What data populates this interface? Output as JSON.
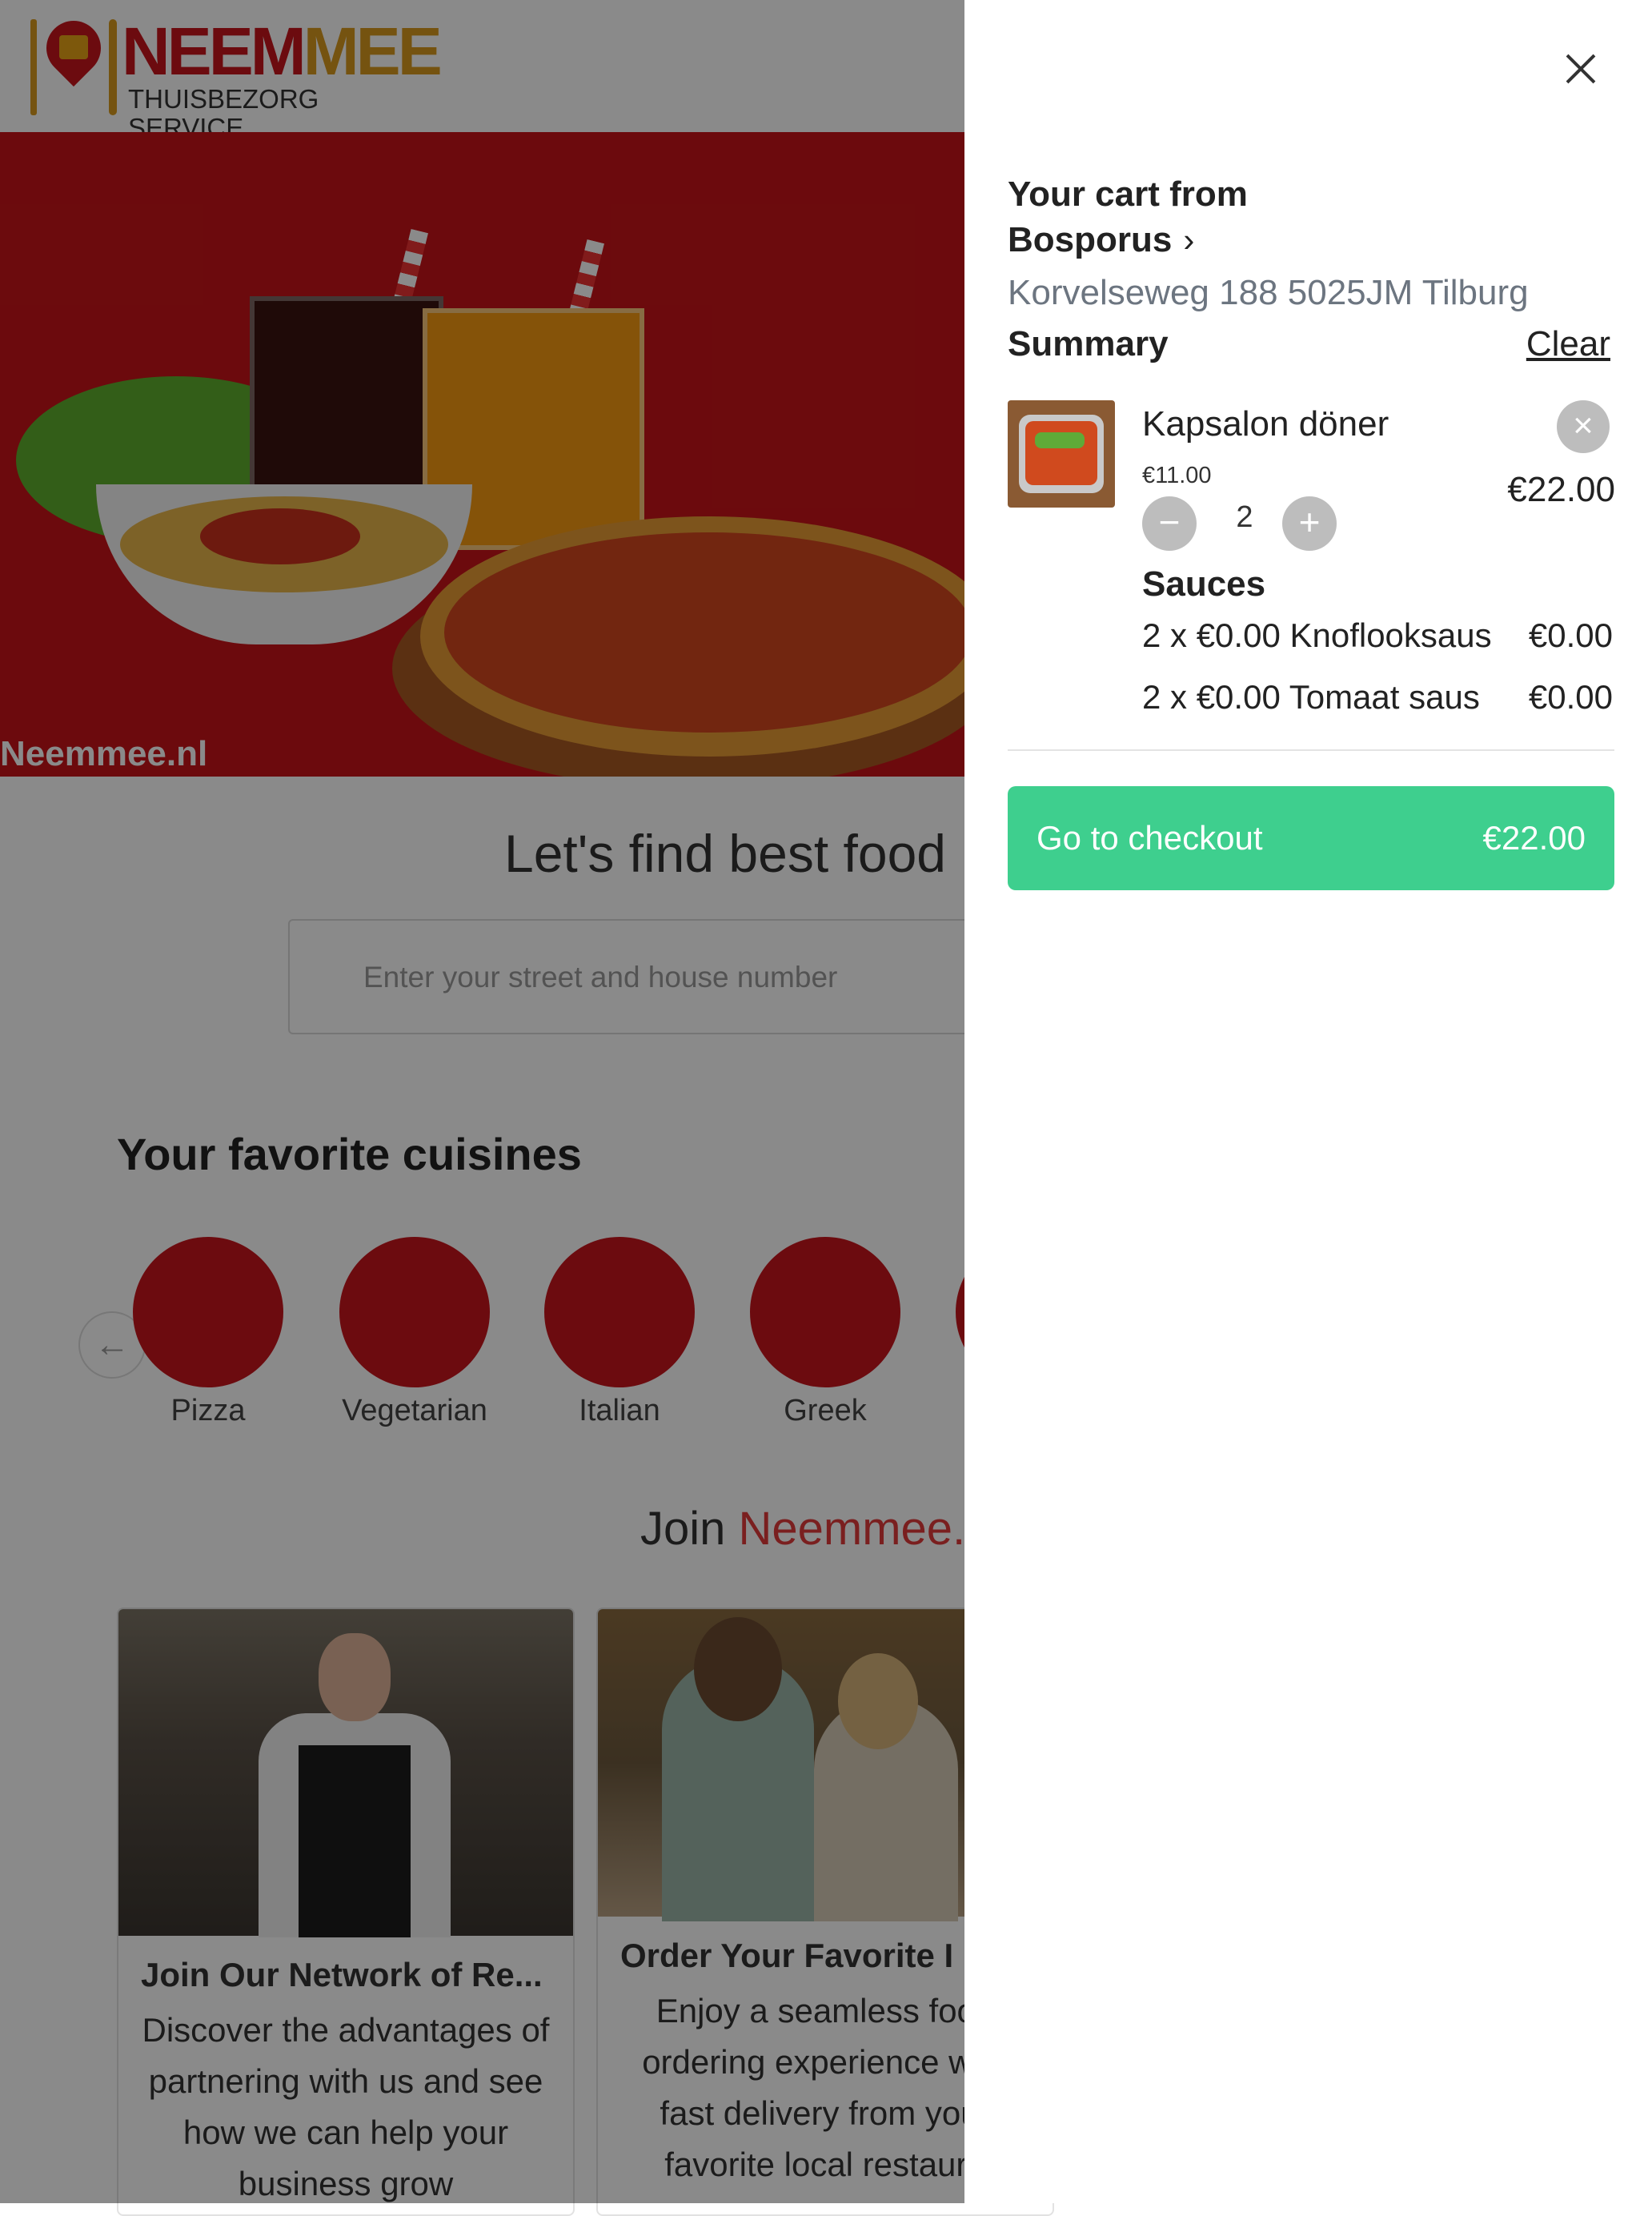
{
  "logo": {
    "brand_part1": "NEEM",
    "brand_part2": "MEE",
    "tagline": "THUISBEZORG SERVICE"
  },
  "hero": {
    "watermark": "Neemmee.nl"
  },
  "search": {
    "title": "Let's find best food",
    "placeholder": "Enter your street and house number"
  },
  "cuisines": {
    "title": "Your favorite cuisines",
    "items": [
      {
        "label": "Pizza"
      },
      {
        "label": "Vegetarian"
      },
      {
        "label": "Italian"
      },
      {
        "label": "Greek"
      }
    ]
  },
  "join": {
    "prefix": "Join ",
    "brand": "Neemmee.",
    "cards": [
      {
        "title": "Join Our Network of Re...",
        "text": "Discover the advantages of partnering with us and see how we can help your business grow"
      },
      {
        "title": "Order Your Favorite I",
        "text": "Enjoy a seamless food ordering experience with fast delivery from your favorite local restaura"
      }
    ]
  },
  "cart": {
    "heading": "Your cart from",
    "restaurant": "Bosporus",
    "restaurant_chevron": "›",
    "address": "Korvelseweg 188 5025JM Tilburg",
    "summary_label": "Summary",
    "clear_label": "Clear",
    "items": [
      {
        "name": "Kapsalon döner",
        "unit_price": "€11.00",
        "quantity": "2",
        "total": "€22.00",
        "sauces_title": "Sauces",
        "sauces": [
          {
            "name": "2 x €0.00 Knoflooksaus",
            "price": "€0.00"
          },
          {
            "name": "2 x €0.00 Tomaat saus",
            "price": "€0.00"
          }
        ]
      }
    ],
    "checkout_label": "Go to checkout",
    "checkout_total": "€22.00"
  },
  "colors": {
    "brand_red": "#c8161d",
    "brand_gold": "#d89a1e",
    "checkout_green": "#3ecf8e",
    "overlay": "rgba(0,0,0,0.46)"
  }
}
